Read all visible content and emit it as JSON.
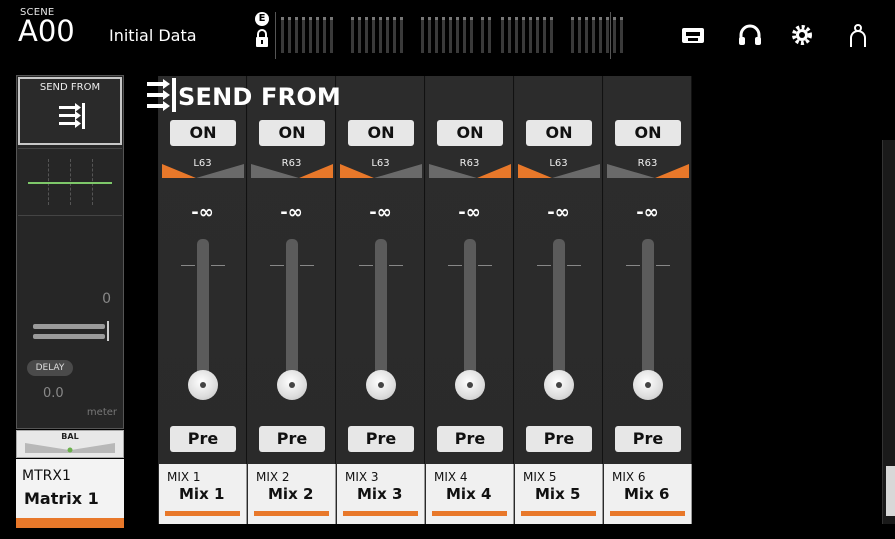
{
  "scene": {
    "caption": "SCENE",
    "number": "A00",
    "title": "Initial Data"
  },
  "status": {
    "badge": "E"
  },
  "top_icons": [
    "recorder-icon",
    "headphones-icon",
    "settings-gear-icon",
    "user-icon"
  ],
  "selected_channel": {
    "sendfrom_label": "SEND FROM",
    "dynamics_value": "0",
    "delay_label": "DELAY",
    "delay_value": "0.0",
    "delay_unit": "meter",
    "bal_label": "BAL",
    "id": "MTRX1",
    "name": "Matrix 1",
    "color": "#e8782a",
    "eq_color": "#7ec86a"
  },
  "send_from": {
    "header": "SEND FROM",
    "channels": [
      {
        "on": "ON",
        "pan": "L63",
        "level": "-∞",
        "pre": "Pre",
        "id": "MIX 1",
        "name": "Mix 1"
      },
      {
        "on": "ON",
        "pan": "R63",
        "level": "-∞",
        "pre": "Pre",
        "id": "MIX 2",
        "name": "Mix 2"
      },
      {
        "on": "ON",
        "pan": "L63",
        "level": "-∞",
        "pre": "Pre",
        "id": "MIX 3",
        "name": "Mix 3"
      },
      {
        "on": "ON",
        "pan": "R63",
        "level": "-∞",
        "pre": "Pre",
        "id": "MIX 4",
        "name": "Mix 4"
      },
      {
        "on": "ON",
        "pan": "L63",
        "level": "-∞",
        "pre": "Pre",
        "id": "MIX 5",
        "name": "Mix 5"
      },
      {
        "on": "ON",
        "pan": "R63",
        "level": "-∞",
        "pre": "Pre",
        "id": "MIX 6",
        "name": "Mix 6"
      }
    ]
  },
  "colors": {
    "accent": "#e8782a",
    "on_button": "#e7e7e7",
    "panel": "#2a2a2a"
  }
}
